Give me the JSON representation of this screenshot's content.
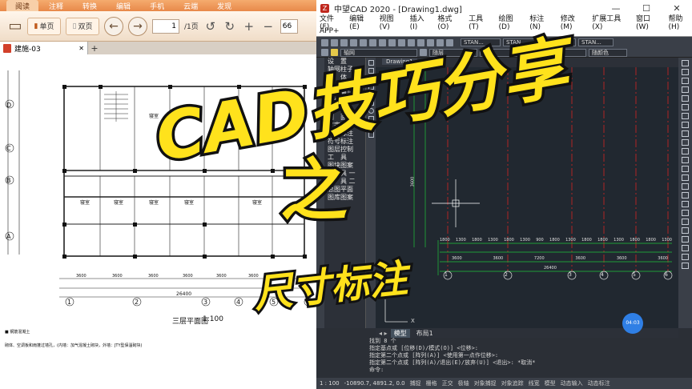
{
  "pdf": {
    "tabs": [
      "阅读",
      "注释",
      "转换",
      "编辑",
      "手机",
      "云端",
      "发现"
    ],
    "active_tab_index": 0,
    "toolbar": {
      "single_page": "单页",
      "double_page": "双页",
      "page_current": "1",
      "page_total": "/1页",
      "zoom": "66"
    },
    "doc_tab": "建施-03",
    "plan": {
      "axis_letters": [
        "D",
        "C",
        "B",
        "A"
      ],
      "axis_numbers": [
        "1",
        "2",
        "3",
        "4",
        "5",
        "6"
      ],
      "dim_top": [
        "1800",
        "1800",
        "1800",
        "1800",
        "1800",
        "1800",
        "1800",
        "1800",
        "1800"
      ],
      "dim_bottom": [
        "3600",
        "3600",
        "3600",
        "3600",
        "3600",
        "3600",
        "3600"
      ],
      "dim_total": "26400",
      "room_label": "寝室",
      "plan_title": "三层平面图",
      "plan_scale": "1:100",
      "notes": [
        "■ 钢筋混凝土",
        "砌体、空调板和雨蓬过墙孔，(内墙：加气混凝土砌块，外墙：JTY型保温砌块)"
      ]
    }
  },
  "cad": {
    "title": "中望CAD 2020 - [Drawing1.dwg]",
    "window_controls": [
      "—",
      "☐",
      "✕"
    ],
    "menu": [
      "文件(F)",
      "编辑(E)",
      "视图(V)",
      "插入(I)",
      "格式(O)",
      "工具(T)",
      "绘图(D)",
      "标注(N)",
      "修改(M)",
      "扩展工具(X)",
      "窗口(W)",
      "帮助(H)"
    ],
    "app_menu": "APP+",
    "combos1": [
      "STAN...",
      "STAN...",
      "Stan...",
      "STAN..."
    ],
    "combos2": [
      "轴网",
      "随层",
      "随层",
      "随层",
      "随颜色"
    ],
    "sidebar": [
      "设　置",
      "轴网柱子",
      "墙　体",
      "门　窗",
      "房间屋顶",
      "楼梯其他",
      "立　面",
      "剖　面",
      "文字表格",
      "尺寸标注",
      "符号标注",
      "图层控制",
      "工　具",
      "图块图案",
      "工　具 一",
      "工　具 二",
      "总图平面",
      "图库图案"
    ],
    "drawing_tab": "Drawing1",
    "dims_upper": [
      "1800",
      "1300",
      "1800",
      "1300",
      "1800",
      "1300",
      "900",
      "1800",
      "1300",
      "1800",
      "1800",
      "1300",
      "1800",
      "1800",
      "1300"
    ],
    "dims_mid": [
      "3600",
      "3600",
      "7200",
      "3600",
      "3600",
      "3600"
    ],
    "dim_total": "26400",
    "dim_vertical": [
      "6900",
      "3600"
    ],
    "axis_labels": [
      "1",
      "2",
      "3",
      "4",
      "5",
      "6"
    ],
    "model_tabs": [
      "模型",
      "布局1"
    ],
    "command_history": [
      "找到 8 个",
      "指定基点或 [位移(D)/模式(O)] <位移>:",
      "指定第二个点或 [阵列(A)] <使用第一点作位移>:",
      "指定第二个点或 [阵列(A)/退出(E)/放弃(U)] <退出>: *取消*",
      "命令:"
    ],
    "status": {
      "scale": "1 : 100",
      "coords": "-10890.7, 4891.2, 0.0",
      "toggles": [
        "捕捉",
        "栅格",
        "正交",
        "极轴",
        "对象捕捉",
        "对象追踪",
        "线宽",
        "模型",
        "动态输入",
        "动态标注"
      ]
    },
    "badge": "04:03"
  },
  "overlay": {
    "title": "CAD技巧分享",
    "zhi": "之",
    "subtitle": "尺寸标注",
    "colors": {
      "fill": "#ffe21c",
      "stroke": "#111111"
    }
  }
}
